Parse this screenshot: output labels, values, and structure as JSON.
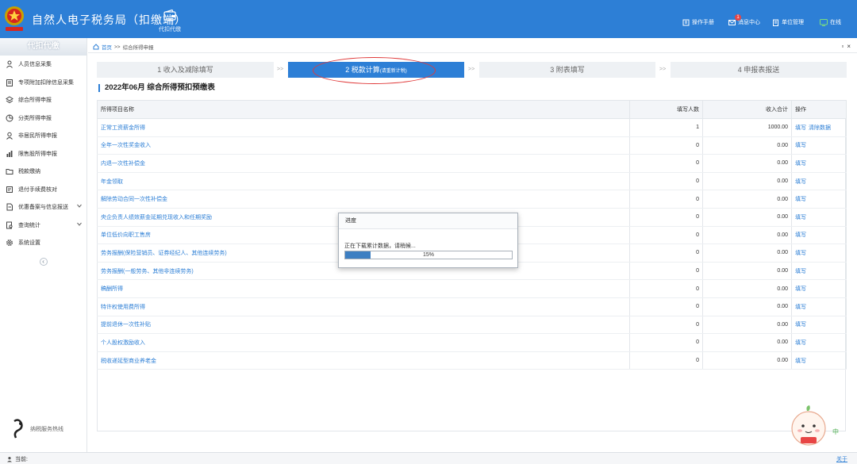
{
  "header": {
    "app_title": "自然人电子税务局（扣缴端）",
    "nav_tile": "代扣代缴",
    "items": [
      {
        "label": "操作手册",
        "icon": "manual-icon"
      },
      {
        "label": "消息中心",
        "icon": "message-icon",
        "badge": "1"
      },
      {
        "label": "单位管理",
        "icon": "building-icon"
      },
      {
        "label": "在线",
        "icon": "online-icon"
      }
    ],
    "colors": {
      "primary": "#2d7fd6",
      "badge": "#e84545"
    }
  },
  "sidebar": {
    "title": "代扣代缴",
    "items": [
      {
        "label": "人员信息采集",
        "icon": "person-icon",
        "expandable": false
      },
      {
        "label": "专项附加扣除信息采集",
        "icon": "clipboard-icon",
        "expandable": false
      },
      {
        "label": "综合所得申报",
        "icon": "layers-icon",
        "expandable": false
      },
      {
        "label": "分类所得申报",
        "icon": "pie-icon",
        "expandable": false
      },
      {
        "label": "非居民所得申报",
        "icon": "user-outline-icon",
        "expandable": false
      },
      {
        "label": "限售股所得申报",
        "icon": "bar-chart-icon",
        "expandable": false
      },
      {
        "label": "税款缴纳",
        "icon": "folder-icon",
        "expandable": false
      },
      {
        "label": "退付手续费核对",
        "icon": "receipt-icon",
        "expandable": false
      },
      {
        "label": "优惠备案与信息报送",
        "icon": "document-icon",
        "expandable": true
      },
      {
        "label": "查询统计",
        "icon": "search-doc-icon",
        "expandable": true
      },
      {
        "label": "系统设置",
        "icon": "gear-icon",
        "expandable": false
      }
    ],
    "hotline_label": "纳税服务热线"
  },
  "breadcrumb": {
    "home": "首页",
    "sep": ">>",
    "current": "综合所得申报"
  },
  "steps": [
    {
      "label": "1 收入及减除填写",
      "sub": "",
      "active": false
    },
    {
      "label": "2 税款计算",
      "sub": "(请重新计税)",
      "active": true
    },
    {
      "label": "3 附表填写",
      "sub": "",
      "active": false
    },
    {
      "label": "4 申报表报送",
      "sub": "",
      "active": false
    }
  ],
  "step_separator": ">>",
  "form_title": "2022年06月  综合所得预扣预缴表",
  "table": {
    "headers": [
      "所得项目名称",
      "填写人数",
      "收入合计",
      "操作"
    ],
    "rows": [
      {
        "name": "正常工资薪金所得",
        "count": "1",
        "income": "1000.00",
        "ops": [
          "填写",
          "清除数据"
        ]
      },
      {
        "name": "全年一次性奖金收入",
        "count": "0",
        "income": "0.00",
        "ops": [
          "填写"
        ]
      },
      {
        "name": "内退一次性补偿金",
        "count": "0",
        "income": "0.00",
        "ops": [
          "填写"
        ]
      },
      {
        "name": "年金领取",
        "count": "0",
        "income": "0.00",
        "ops": [
          "填写"
        ]
      },
      {
        "name": "解除劳动合同一次性补偿金",
        "count": "0",
        "income": "0.00",
        "ops": [
          "填写"
        ]
      },
      {
        "name": "央企负责人绩效薪金延期兑现收入和任期奖励",
        "count": "0",
        "income": "0.00",
        "ops": [
          "填写"
        ]
      },
      {
        "name": "单位低价向职工售房",
        "count": "0",
        "income": "0.00",
        "ops": [
          "填写"
        ]
      },
      {
        "name": "劳务报酬(保险营销员、证券经纪人、其他连续劳务)",
        "count": "0",
        "income": "0.00",
        "ops": [
          "填写"
        ]
      },
      {
        "name": "劳务报酬(一般劳务、其他非连续劳务)",
        "count": "0",
        "income": "0.00",
        "ops": [
          "填写"
        ]
      },
      {
        "name": "稿酬所得",
        "count": "0",
        "income": "0.00",
        "ops": [
          "填写"
        ]
      },
      {
        "name": "特许权使用费所得",
        "count": "0",
        "income": "0.00",
        "ops": [
          "填写"
        ]
      },
      {
        "name": "提前退休一次性补贴",
        "count": "0",
        "income": "0.00",
        "ops": [
          "填写"
        ]
      },
      {
        "name": "个人股权激励收入",
        "count": "0",
        "income": "0.00",
        "ops": [
          "填写"
        ]
      },
      {
        "name": "税收递延型商业养老金",
        "count": "0",
        "income": "0.00",
        "ops": [
          "填写"
        ]
      }
    ]
  },
  "progress_dialog": {
    "title": "进度",
    "message": "正在下载累计数据，请稍候...",
    "percent": 15,
    "percent_label": "15%",
    "fill_color": "#3d7fc2"
  },
  "mascot": {
    "lang_badge": "中"
  },
  "statusbar": {
    "left_label": "当前:",
    "right_link": "关于"
  }
}
